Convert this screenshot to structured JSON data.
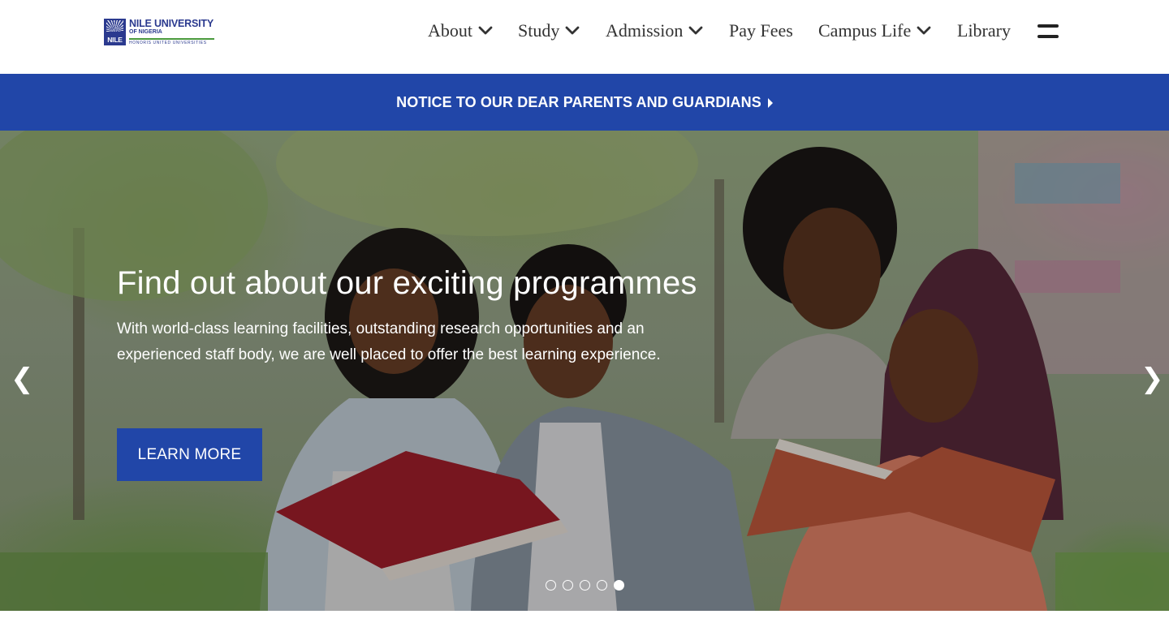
{
  "logo": {
    "mark_text": "NILE",
    "name": "NILE UNIVERSITY",
    "sub": "OF NIGERIA",
    "tagline": "HONORIS UNITED UNIVERSITIES"
  },
  "nav": {
    "items": [
      {
        "label": "About",
        "has_dropdown": true
      },
      {
        "label": "Study",
        "has_dropdown": true
      },
      {
        "label": "Admission",
        "has_dropdown": true
      },
      {
        "label": "Pay Fees",
        "has_dropdown": false
      },
      {
        "label": "Campus Life",
        "has_dropdown": true
      },
      {
        "label": "Library",
        "has_dropdown": false
      }
    ],
    "menu_icon": "hamburger-icon"
  },
  "notice": {
    "text": "NOTICE TO OUR DEAR PARENTS AND GUARDIANS",
    "icon": "caret-right-icon"
  },
  "hero": {
    "title": "Find out about our exciting programmes",
    "description": "With world-class learning facilities, outstanding research opportunities and an experienced staff body, we are well placed to offer the best learning experience.",
    "button_label": "LEARN MORE",
    "prev_arrow": "❮",
    "next_arrow": "❯",
    "slide_count": 5,
    "active_slide": 5
  },
  "colors": {
    "brand_blue": "#2146a8",
    "logo_blue": "#2b3a8f",
    "logo_green": "#4a9a3d",
    "nav_text": "#333333"
  }
}
